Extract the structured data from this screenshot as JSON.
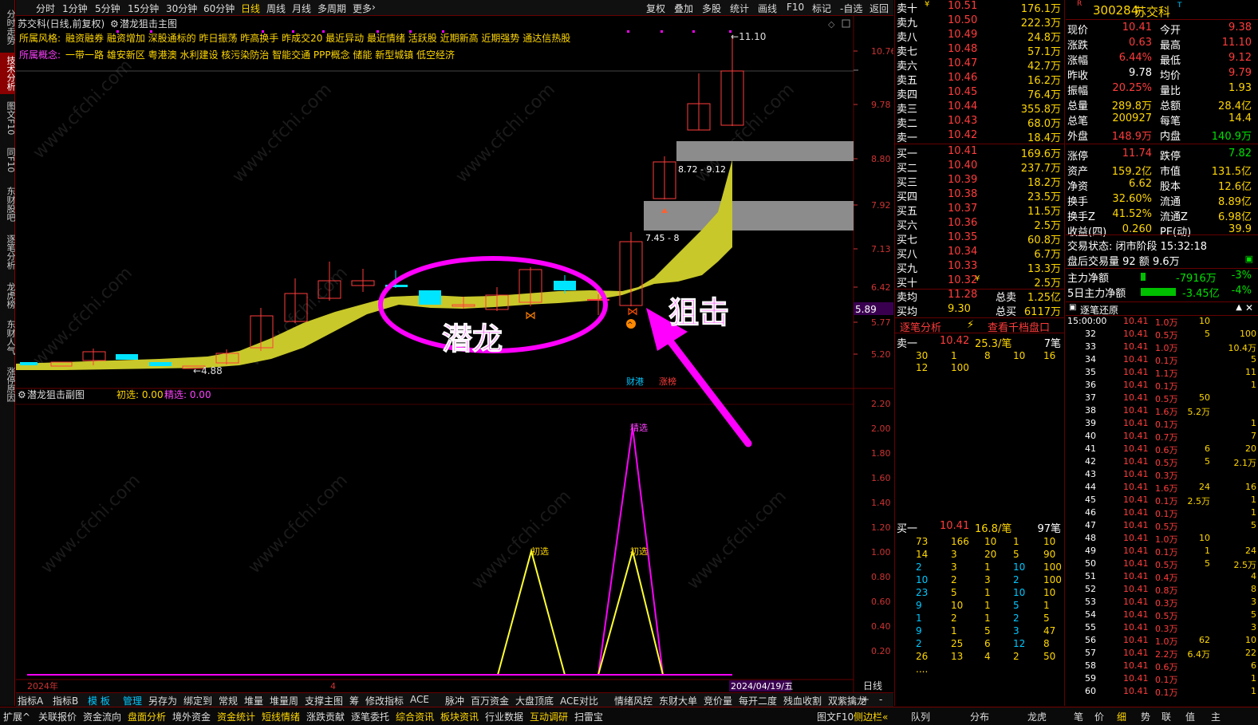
{
  "left_sidebar": [
    {
      "label": "分时走势",
      "active": false
    },
    {
      "label": "技术分析",
      "active": true
    },
    {
      "label": "图文F10",
      "active": false
    },
    {
      "label": "同F10",
      "active": false
    },
    {
      "label": "东财股吧",
      "active": false
    },
    {
      "label": "逐笔分析",
      "active": false
    },
    {
      "label": "龙虎榜",
      "active": false
    },
    {
      "label": "东财人气",
      "active": false
    },
    {
      "label": "涨停原因",
      "active": false
    }
  ],
  "toolbar": {
    "periods": [
      "分时",
      "1分钟",
      "5分钟",
      "15分钟",
      "30分钟",
      "60分钟",
      "日线",
      "周线",
      "月线",
      "多周期",
      "更多"
    ],
    "active_period": "日线",
    "more_arrow": "›",
    "right": [
      "复权",
      "叠加",
      "多股",
      "统计",
      "画线",
      "F10",
      "标记",
      "-自选",
      "返回"
    ]
  },
  "chart": {
    "title": "苏交科(日线,前复权)",
    "main_indicator": "潜龙狙击主图",
    "style_label": "所属风格:",
    "styles": "融资融券 融资增加 深股通标的 昨日振荡 昨高换手 昨成交20 最近异动 最近情绪 活跃股 近期新高 近期强势 通达信热股",
    "concept_label": "所属概念:",
    "concepts": "一带一路 雄安新区 粤港澳 水利建设 核污染防治 智能交通 PPP概念 储能 新型城镇 低空经济",
    "price_axis": [
      "10.76",
      "9.78",
      "8.80",
      "7.92",
      "7.13",
      "6.42",
      "5.77",
      "5.20"
    ],
    "current_price_marker": "5.89",
    "high_label": "11.10",
    "low_label": "4.88",
    "zone_upper_label": "8.72 - 9.12",
    "zone_lower_label": "7.45 - 8",
    "annotation_qianlong": "潜龙",
    "annotation_juji": "狙击",
    "badge_caigang": "财港",
    "badge_zhangbang": "涨榜",
    "sub_title": "潜龙狙击副图",
    "sub_legend_chuxuan": "初选: 0.00",
    "sub_legend_jingxuan": "精选: 0.00",
    "sub_axis": [
      "2.20",
      "2.00",
      "1.80",
      "1.60",
      "1.40",
      "1.20",
      "1.00",
      "0.80",
      "0.60",
      "0.40",
      "0.20"
    ],
    "sub_label_chuxuan": "初选",
    "sub_label_jingxuan": "精选",
    "date_left": "2024年",
    "date_mid": "4",
    "date_right": "2024/04/19/五",
    "period_label": "日线",
    "watermark": "www.cfchi.com"
  },
  "orderbook": {
    "asks": [
      {
        "label": "卖十",
        "flag": "¥",
        "price": "10.51",
        "vol": "176.1万"
      },
      {
        "label": "卖九",
        "flag": "",
        "price": "10.50",
        "vol": "222.3万"
      },
      {
        "label": "卖八",
        "flag": "",
        "price": "10.49",
        "vol": "24.8万"
      },
      {
        "label": "卖七",
        "flag": "",
        "price": "10.48",
        "vol": "57.1万"
      },
      {
        "label": "卖六",
        "flag": "",
        "price": "10.47",
        "vol": "42.7万"
      },
      {
        "label": "卖五",
        "flag": "",
        "price": "10.46",
        "vol": "16.2万"
      },
      {
        "label": "卖四",
        "flag": "",
        "price": "10.45",
        "vol": "76.4万"
      },
      {
        "label": "卖三",
        "flag": "",
        "price": "10.44",
        "vol": "355.8万"
      },
      {
        "label": "卖二",
        "flag": "",
        "price": "10.43",
        "vol": "68.0万"
      },
      {
        "label": "卖一",
        "flag": "",
        "price": "10.42",
        "vol": "18.4万"
      }
    ],
    "bids": [
      {
        "label": "买一",
        "flag": "",
        "price": "10.41",
        "vol": "169.6万"
      },
      {
        "label": "买二",
        "flag": "",
        "price": "10.40",
        "vol": "237.7万"
      },
      {
        "label": "买三",
        "flag": "",
        "price": "10.39",
        "vol": "18.2万"
      },
      {
        "label": "买四",
        "flag": "",
        "price": "10.38",
        "vol": "23.5万"
      },
      {
        "label": "买五",
        "flag": "",
        "price": "10.37",
        "vol": "11.5万"
      },
      {
        "label": "买六",
        "flag": "",
        "price": "10.36",
        "vol": "2.5万"
      },
      {
        "label": "买七",
        "flag": "",
        "price": "10.35",
        "vol": "60.8万"
      },
      {
        "label": "买八",
        "flag": "",
        "price": "10.34",
        "vol": "6.7万"
      },
      {
        "label": "买九",
        "flag": "",
        "price": "10.33",
        "vol": "13.3万"
      },
      {
        "label": "买十",
        "flag": "¥",
        "price": "10.32",
        "vol": "2.5万"
      }
    ],
    "sell_avg_label": "卖均",
    "sell_avg": "11.28",
    "sell_total_label": "总卖",
    "sell_total": "1.25亿",
    "buy_avg_label": "买均",
    "buy_avg": "9.30",
    "buy_total_label": "总买",
    "buy_total": "6117万",
    "tab_tick": "逐笔分析",
    "tab_queue": "查看千档盘口",
    "ask1_label": "卖一",
    "ask1_price": "10.42",
    "ask1_per": "25.3/笔",
    "ask1_count": "7笔",
    "ask1_queue": [
      [
        "30",
        "1",
        "8",
        "10",
        "16"
      ],
      [
        "12",
        "100",
        "",
        "",
        ""
      ]
    ],
    "bid1_label": "买一",
    "bid1_price": "10.41",
    "bid1_per": "16.8/笔",
    "bid1_count": "97笔",
    "bid1_queue": [
      [
        "73",
        "166",
        "10",
        "1",
        "10"
      ],
      [
        "14",
        "3",
        "20",
        "5",
        "90"
      ],
      [
        "2",
        "3",
        "1",
        "10",
        "100"
      ],
      [
        "10",
        "2",
        "3",
        "2",
        "100"
      ],
      [
        "23",
        "5",
        "1",
        "10",
        "10"
      ],
      [
        "9",
        "10",
        "1",
        "5",
        "1"
      ],
      [
        "1",
        "2",
        "1",
        "2",
        "5"
      ],
      [
        "9",
        "1",
        "5",
        "3",
        "47"
      ],
      [
        "2",
        "25",
        "6",
        "12",
        "8"
      ],
      [
        "26",
        "13",
        "4",
        "2",
        "50"
      ],
      [
        "....",
        "",
        "",
        "",
        ""
      ]
    ]
  },
  "info": {
    "code": "300284",
    "name": "苏交科",
    "tag": "T",
    "rz": "R",
    "rows": [
      [
        "现价",
        "10.41",
        "今开",
        "9.38"
      ],
      [
        "涨跌",
        "0.63",
        "最高",
        "11.10"
      ],
      [
        "涨幅",
        "6.44%",
        "最低",
        "9.12"
      ],
      [
        "昨收",
        "9.78",
        "均价",
        "9.79"
      ],
      [
        "振幅",
        "20.25%",
        "量比",
        "1.93"
      ],
      [
        "总量",
        "289.8万",
        "总额",
        "28.4亿"
      ],
      [
        "总笔",
        "200927",
        "每笔",
        "14.4"
      ],
      [
        "外盘",
        "148.9万",
        "内盘",
        "140.9万"
      ],
      [
        "涨停",
        "11.74",
        "跌停",
        "7.82"
      ],
      [
        "资产",
        "159.2亿",
        "市值",
        "131.5亿"
      ],
      [
        "净资",
        "6.62",
        "股本",
        "12.6亿"
      ],
      [
        "换手",
        "32.60%",
        "流通",
        "8.89亿"
      ],
      [
        "换手Z",
        "41.52%",
        "流通Z",
        "6.98亿"
      ],
      [
        "收益(四)",
        "0.260",
        "PE(动)",
        "39.9"
      ]
    ],
    "trade_state": "交易状态: 闭市阶段 15:32:18",
    "after_trade": "盘后交易量 92 额 9.6万",
    "main_flow_label": "主力净额",
    "main_flow": "-7916万",
    "main_flow_pct": "-3%",
    "main5_label": "5日主力净额",
    "main5": "-3.45亿",
    "main5_pct": "-4%",
    "ticks_title": "逐笔还原"
  },
  "ticks": [
    [
      "15:00:00",
      "10.41",
      "1.0万",
      "10",
      ""
    ],
    [
      "32",
      "10.41",
      "0.5万",
      "5",
      "100"
    ],
    [
      "33",
      "10.41",
      "1.0万",
      "",
      "10.4万"
    ],
    [
      "34",
      "10.41",
      "0.1万",
      "",
      "5"
    ],
    [
      "35",
      "10.41",
      "1.1万",
      "",
      "11"
    ],
    [
      "36",
      "10.41",
      "0.1万",
      "",
      "1"
    ],
    [
      "37",
      "10.41",
      "0.5万",
      "50",
      ""
    ],
    [
      "38",
      "10.41",
      "1.6万",
      "5.2万",
      ""
    ],
    [
      "39",
      "10.41",
      "0.1万",
      "",
      "1"
    ],
    [
      "40",
      "10.41",
      "0.7万",
      "",
      "7"
    ],
    [
      "41",
      "10.41",
      "0.6万",
      "6",
      "20"
    ],
    [
      "42",
      "10.41",
      "0.5万",
      "5",
      "2.1万"
    ],
    [
      "43",
      "10.41",
      "0.3万",
      "",
      ""
    ],
    [
      "44",
      "10.41",
      "1.6万",
      "24",
      "16"
    ],
    [
      "45",
      "10.41",
      "0.1万",
      "2.5万",
      "1"
    ],
    [
      "46",
      "10.41",
      "0.1万",
      "",
      "1"
    ],
    [
      "47",
      "10.41",
      "0.5万",
      "",
      "5"
    ],
    [
      "48",
      "10.41",
      "1.0万",
      "10",
      ""
    ],
    [
      "49",
      "10.41",
      "0.1万",
      "1",
      "24"
    ],
    [
      "50",
      "10.41",
      "0.5万",
      "5",
      "2.5万"
    ],
    [
      "51",
      "10.41",
      "0.4万",
      "",
      "4"
    ],
    [
      "52",
      "10.41",
      "0.8万",
      "",
      "8"
    ],
    [
      "53",
      "10.41",
      "0.3万",
      "",
      "3"
    ],
    [
      "54",
      "10.41",
      "0.5万",
      "",
      "5"
    ],
    [
      "55",
      "10.41",
      "0.3万",
      "",
      "3"
    ],
    [
      "56",
      "10.41",
      "1.0万",
      "62",
      "10"
    ],
    [
      "57",
      "10.41",
      "2.2万",
      "6.4万",
      "22"
    ],
    [
      "58",
      "10.41",
      "0.6万",
      "",
      "6"
    ],
    [
      "59",
      "10.41",
      "0.1万",
      "",
      "1"
    ],
    [
      "60",
      "10.41",
      "0.1万",
      "",
      "1"
    ]
  ],
  "bottom_tabs": [
    "指标A",
    "指标B",
    "模 板",
    "管理",
    "另存为",
    "绑定到",
    "常规",
    "堆量",
    "堆量周",
    "支撑主图",
    "筹",
    "修改指标",
    "ACE",
    "脉冲",
    "百万资金",
    "大盘顶底",
    "ACE对比",
    "情绪风控",
    "东财大单",
    "竞价量",
    "每开二度",
    "残血收割",
    "双紫擒龙"
  ],
  "bottom_tabs_extra": [
    "+",
    "-"
  ],
  "bottom_bar": [
    "扩展^",
    "关联报价",
    "资金流向",
    "盘面分析",
    "境外资金",
    "资金统计",
    "短线情绪",
    "涨跌贡献",
    "逐笔委托",
    "综合资讯",
    "板块资讯",
    "行业数据",
    "互动调研",
    "扫雷宝"
  ],
  "bottom_bar_right": [
    "图文F10",
    "侧边栏«"
  ],
  "bottom_right_tabs": [
    "队列",
    "分布",
    "龙虎",
    "笔",
    "价",
    "细",
    "势",
    "联",
    "值",
    "主"
  ]
}
